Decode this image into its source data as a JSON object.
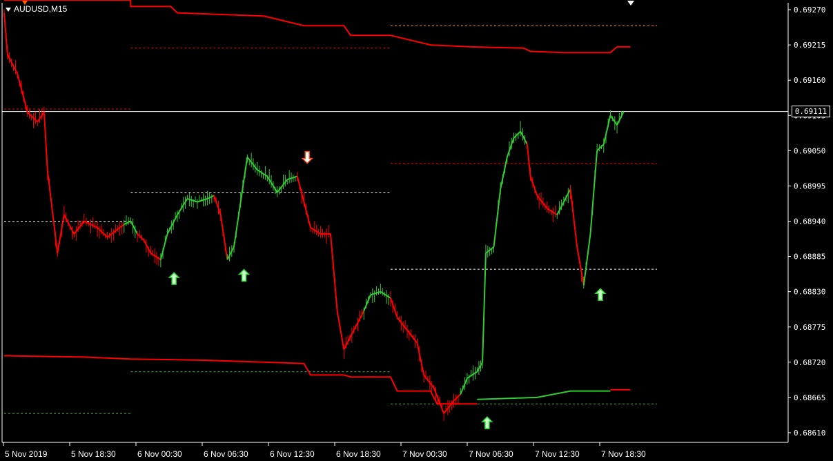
{
  "window": {
    "title": "AUDUSD,M15"
  },
  "price_tag": {
    "value": "0.69111"
  },
  "colors": {
    "background": "#000000",
    "bull": "#32cd32",
    "bear": "#ff0000",
    "grid": "#ffffff",
    "band": "#ff0000",
    "band_bull": "#32cd32"
  },
  "chart_data": {
    "type": "line",
    "symbol": "AUDUSD",
    "timeframe": "M15",
    "y_axis": {
      "ticks": [
        0.6927,
        0.69215,
        0.6916,
        0.69105,
        0.6905,
        0.68995,
        0.6894,
        0.68885,
        0.6883,
        0.68775,
        0.6872,
        0.68665,
        0.6861
      ],
      "tick_labels": [
        "0.69270",
        "0.69215",
        "0.69160",
        "0.69105",
        "0.69050",
        "0.68995",
        "0.68940",
        "0.68885",
        "0.68830",
        "0.68775",
        "0.68720",
        "0.68665",
        "0.68610"
      ],
      "ylim": [
        0.686,
        0.6928
      ]
    },
    "x_axis": {
      "tick_labels": [
        "5 Nov 2019",
        "5 Nov 18:30",
        "6 Nov 00:30",
        "6 Nov 06:30",
        "6 Nov 12:30",
        "6 Nov 18:30",
        "7 Nov 00:30",
        "7 Nov 06:30",
        "7 Nov 12:30",
        "7 Nov 18:30"
      ]
    },
    "current_price": 0.69111,
    "price_series": [
      {
        "t": 0,
        "p": 0.69265,
        "c": "bull"
      },
      {
        "t": 0.5,
        "p": 0.692,
        "c": "bear"
      },
      {
        "t": 2,
        "p": 0.6917,
        "c": "bear"
      },
      {
        "t": 3.5,
        "p": 0.6911,
        "c": "bear"
      },
      {
        "t": 5,
        "p": 0.69095,
        "c": "bear"
      },
      {
        "t": 6,
        "p": 0.6911,
        "c": "bear"
      },
      {
        "t": 6.5,
        "p": 0.6902,
        "c": "bear"
      },
      {
        "t": 8,
        "p": 0.6889,
        "c": "bear"
      },
      {
        "t": 9,
        "p": 0.6895,
        "c": "bear"
      },
      {
        "t": 10.5,
        "p": 0.6892,
        "c": "bear"
      },
      {
        "t": 12,
        "p": 0.6894,
        "c": "bear"
      },
      {
        "t": 14,
        "p": 0.6893,
        "c": "bear"
      },
      {
        "t": 15.5,
        "p": 0.68915,
        "c": "bear"
      },
      {
        "t": 18,
        "p": 0.68935,
        "c": "bear"
      },
      {
        "t": 19,
        "p": 0.6894,
        "c": "bull"
      },
      {
        "t": 20,
        "p": 0.6892,
        "c": "bull"
      },
      {
        "t": 21,
        "p": 0.6891,
        "c": "bear"
      },
      {
        "t": 22,
        "p": 0.6889,
        "c": "bear"
      },
      {
        "t": 23.5,
        "p": 0.6888,
        "c": "bear"
      },
      {
        "t": 24.5,
        "p": 0.6892,
        "c": "bull"
      },
      {
        "t": 26,
        "p": 0.6895,
        "c": "bull"
      },
      {
        "t": 27.5,
        "p": 0.68975,
        "c": "bull"
      },
      {
        "t": 29,
        "p": 0.6897,
        "c": "bull"
      },
      {
        "t": 30.5,
        "p": 0.68975,
        "c": "bull"
      },
      {
        "t": 31.5,
        "p": 0.6898,
        "c": "bull"
      },
      {
        "t": 32.5,
        "p": 0.6895,
        "c": "bear"
      },
      {
        "t": 33.5,
        "p": 0.6888,
        "c": "bear"
      },
      {
        "t": 34.5,
        "p": 0.689,
        "c": "bull"
      },
      {
        "t": 35.5,
        "p": 0.6897,
        "c": "bull"
      },
      {
        "t": 36.5,
        "p": 0.6904,
        "c": "bull"
      },
      {
        "t": 38,
        "p": 0.6902,
        "c": "bull"
      },
      {
        "t": 39.5,
        "p": 0.6901,
        "c": "bull"
      },
      {
        "t": 41,
        "p": 0.68985,
        "c": "bull"
      },
      {
        "t": 42.5,
        "p": 0.69005,
        "c": "bull"
      },
      {
        "t": 44,
        "p": 0.6901,
        "c": "bull"
      },
      {
        "t": 45,
        "p": 0.6897,
        "c": "bear"
      },
      {
        "t": 46,
        "p": 0.6893,
        "c": "bear"
      },
      {
        "t": 47.5,
        "p": 0.6892,
        "c": "bear"
      },
      {
        "t": 49,
        "p": 0.6892,
        "c": "bear"
      },
      {
        "t": 50,
        "p": 0.688,
        "c": "bear"
      },
      {
        "t": 51,
        "p": 0.6874,
        "c": "bear"
      },
      {
        "t": 52.5,
        "p": 0.6877,
        "c": "bear"
      },
      {
        "t": 54,
        "p": 0.688,
        "c": "bear"
      },
      {
        "t": 55,
        "p": 0.68825,
        "c": "bull"
      },
      {
        "t": 56.5,
        "p": 0.6883,
        "c": "bull"
      },
      {
        "t": 58,
        "p": 0.6882,
        "c": "bull"
      },
      {
        "t": 59,
        "p": 0.6879,
        "c": "bear"
      },
      {
        "t": 60.5,
        "p": 0.6877,
        "c": "bear"
      },
      {
        "t": 62,
        "p": 0.6875,
        "c": "bear"
      },
      {
        "t": 63,
        "p": 0.687,
        "c": "bear"
      },
      {
        "t": 64.5,
        "p": 0.6868,
        "c": "bear"
      },
      {
        "t": 66,
        "p": 0.6864,
        "c": "bear"
      },
      {
        "t": 67.5,
        "p": 0.6866,
        "c": "bear"
      },
      {
        "t": 68.5,
        "p": 0.6867,
        "c": "bear"
      },
      {
        "t": 69.5,
        "p": 0.68695,
        "c": "bull"
      },
      {
        "t": 71,
        "p": 0.68705,
        "c": "bull"
      },
      {
        "t": 71.8,
        "p": 0.6872,
        "c": "bull"
      },
      {
        "t": 72.3,
        "p": 0.6889,
        "c": "bull"
      },
      {
        "t": 73.5,
        "p": 0.689,
        "c": "bull"
      },
      {
        "t": 74.5,
        "p": 0.6899,
        "c": "bull"
      },
      {
        "t": 75.5,
        "p": 0.6904,
        "c": "bull"
      },
      {
        "t": 76.5,
        "p": 0.6907,
        "c": "bull"
      },
      {
        "t": 77.5,
        "p": 0.6908,
        "c": "bull"
      },
      {
        "t": 78.5,
        "p": 0.6906,
        "c": "bull"
      },
      {
        "t": 79,
        "p": 0.6901,
        "c": "bear"
      },
      {
        "t": 80,
        "p": 0.6898,
        "c": "bear"
      },
      {
        "t": 81.5,
        "p": 0.6896,
        "c": "bear"
      },
      {
        "t": 83,
        "p": 0.6895,
        "c": "bear"
      },
      {
        "t": 84,
        "p": 0.6897,
        "c": "bull"
      },
      {
        "t": 85,
        "p": 0.6899,
        "c": "bull"
      },
      {
        "t": 86,
        "p": 0.689,
        "c": "bear"
      },
      {
        "t": 87,
        "p": 0.6884,
        "c": "bear"
      },
      {
        "t": 88,
        "p": 0.6892,
        "c": "bull"
      },
      {
        "t": 89,
        "p": 0.6905,
        "c": "bull"
      },
      {
        "t": 90,
        "p": 0.6906,
        "c": "bull"
      },
      {
        "t": 91,
        "p": 0.69105,
        "c": "bull"
      },
      {
        "t": 92,
        "p": 0.6909,
        "c": "bull"
      },
      {
        "t": 93,
        "p": 0.69111,
        "c": "bull"
      }
    ],
    "levels": [
      {
        "from": 0,
        "to": 19,
        "p": 0.69115,
        "style": "dash",
        "color": "#ff0000"
      },
      {
        "from": 19,
        "to": 58,
        "p": 0.6921,
        "style": "dash",
        "color": "#ff0000"
      },
      {
        "from": 58,
        "to": 98,
        "p": 0.69245,
        "style": "dash",
        "color": "#ff9955"
      },
      {
        "from": 58,
        "to": 98,
        "p": 0.6903,
        "style": "dash",
        "color": "#ff0000"
      },
      {
        "from": 0,
        "to": 19,
        "p": 0.6894,
        "style": "dash",
        "color": "#ffffff"
      },
      {
        "from": 19,
        "to": 58,
        "p": 0.68985,
        "style": "dash",
        "color": "#ffffff"
      },
      {
        "from": 58,
        "to": 98,
        "p": 0.68865,
        "style": "dash",
        "color": "#ffffff"
      },
      {
        "from": 19,
        "to": 58,
        "p": 0.68705,
        "style": "dash",
        "color": "#55aa55"
      },
      {
        "from": 0,
        "to": 19,
        "p": 0.6864,
        "style": "dash",
        "color": "#55aa55"
      },
      {
        "from": 58,
        "to": 98,
        "p": 0.68655,
        "style": "dash",
        "color": "#55aa55"
      }
    ],
    "upper_band": [
      {
        "t": 0,
        "p": 0.69285
      },
      {
        "t": 19,
        "p": 0.69285
      },
      {
        "t": 19,
        "p": 0.69275
      },
      {
        "t": 25,
        "p": 0.69275
      },
      {
        "t": 26,
        "p": 0.69265
      },
      {
        "t": 39,
        "p": 0.6926
      },
      {
        "t": 45,
        "p": 0.69245
      },
      {
        "t": 51,
        "p": 0.69245
      },
      {
        "t": 52,
        "p": 0.6923
      },
      {
        "t": 58,
        "p": 0.6923
      },
      {
        "t": 64,
        "p": 0.69215
      },
      {
        "t": 70,
        "p": 0.69212
      },
      {
        "t": 78,
        "p": 0.6921
      },
      {
        "t": 79,
        "p": 0.69205
      },
      {
        "t": 84,
        "p": 0.69203
      },
      {
        "t": 91,
        "p": 0.69203
      },
      {
        "t": 92,
        "p": 0.69212
      },
      {
        "t": 94,
        "p": 0.69212
      }
    ],
    "lower_band_bear": [
      {
        "t": 0,
        "p": 0.6873
      },
      {
        "t": 12,
        "p": 0.68728
      },
      {
        "t": 19,
        "p": 0.68725
      },
      {
        "t": 30,
        "p": 0.68723
      },
      {
        "t": 39,
        "p": 0.6872
      },
      {
        "t": 45,
        "p": 0.68718
      },
      {
        "t": 46,
        "p": 0.687
      },
      {
        "t": 51,
        "p": 0.687
      },
      {
        "t": 52,
        "p": 0.68697
      },
      {
        "t": 58,
        "p": 0.68697
      },
      {
        "t": 59,
        "p": 0.68675
      },
      {
        "t": 64,
        "p": 0.68675
      },
      {
        "t": 65,
        "p": 0.68655
      },
      {
        "t": 71,
        "p": 0.68655
      }
    ],
    "lower_band_bull": [
      {
        "t": 71,
        "p": 0.68662
      },
      {
        "t": 80,
        "p": 0.68665
      },
      {
        "t": 85,
        "p": 0.68675
      },
      {
        "t": 91,
        "p": 0.68675
      }
    ],
    "lower_band_tail": [
      {
        "t": 91,
        "p": 0.68677
      },
      {
        "t": 94,
        "p": 0.68677
      }
    ],
    "signals": [
      {
        "t": 25.5,
        "p": 0.6885,
        "dir": "up"
      },
      {
        "t": 36,
        "p": 0.68855,
        "dir": "up"
      },
      {
        "t": 45.5,
        "p": 0.6904,
        "dir": "down"
      },
      {
        "t": 72.5,
        "p": 0.68625,
        "dir": "up"
      },
      {
        "t": 89.5,
        "p": 0.68825,
        "dir": "up"
      }
    ]
  }
}
